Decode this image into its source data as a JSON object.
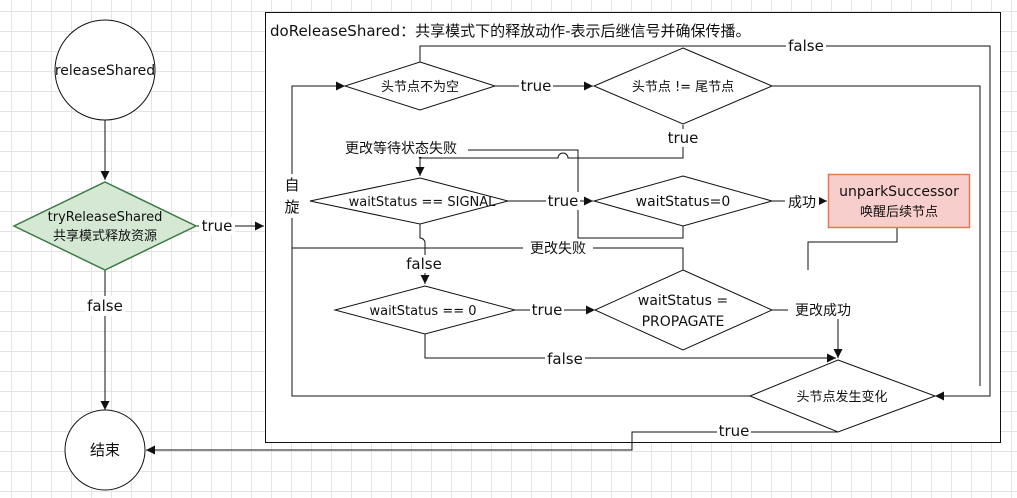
{
  "nodes": {
    "release_shared": "releaseShared",
    "try_release_line1": "tryReleaseShared",
    "try_release_line2": "共享模式释放资源",
    "end": "结束",
    "container_title": "doReleaseShared：共享模式下的释放动作-表示后继信号并确保传播。",
    "head_not_null": "头节点不为空",
    "head_not_tail": "头节点 != 尾节点",
    "ws_signal": "waitStatus == SIGNAL",
    "ws_cas_zero": "waitStatus=0",
    "unpark_line1": "unparkSuccessor",
    "unpark_line2": "唤醒后续节点",
    "ws_zero": "waitStatus == 0",
    "ws_propagate_line1": "waitStatus =",
    "ws_propagate_line2": "PROPAGATE",
    "head_changed": "头节点发生变化",
    "spin_char1": "自",
    "spin_char2": "旋"
  },
  "edges": {
    "try_true": "true",
    "try_false": "false",
    "head_not_null_true": "true",
    "head_not_null_false": "false",
    "head_not_tail_true": "true",
    "cas_signal_fail": "更改等待状态失败",
    "signal_true": "true",
    "cas_success": "成功",
    "signal_false": "false",
    "cas_fail": "更改失败",
    "zero_true": "true",
    "propagate_success": "更改成功",
    "zero_false": "false",
    "changed_true": "true"
  },
  "colors": {
    "decision_green_fill": "#d5e8d4",
    "decision_green_stroke": "#3d7a45",
    "unpark_fill": "#f8cecc",
    "unpark_stroke": "#e07a50",
    "line": "#111111"
  }
}
